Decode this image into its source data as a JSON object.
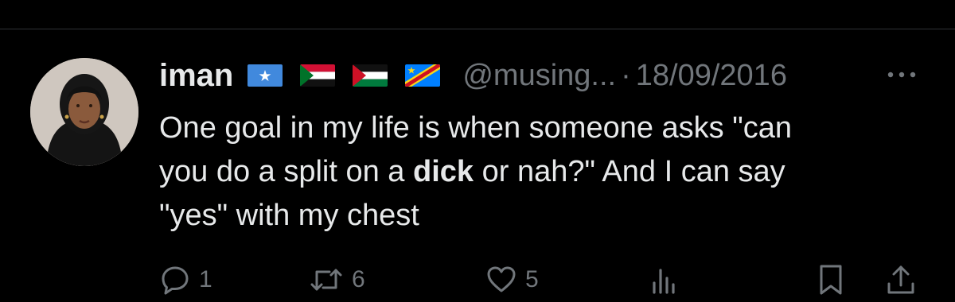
{
  "tweet": {
    "display_name": "iman",
    "handle": "@musing...",
    "separator": "·",
    "date": "18/09/2016",
    "flags": [
      "somalia-flag",
      "sudan-flag",
      "palestine-flag",
      "dr-congo-flag"
    ],
    "text_part1": "One goal in my life is when someone asks \"can\nyou do a split on a ",
    "text_bold": "dick",
    "text_part2": " or nah?\" And I can say\n\"yes\" with my chest"
  },
  "actions": {
    "reply_count": "1",
    "retweet_count": "6",
    "like_count": "5"
  },
  "icons": [
    "more-icon",
    "reply-icon",
    "retweet-icon",
    "like-icon",
    "views-icon",
    "bookmark-icon",
    "share-icon"
  ],
  "colors": {
    "background": "#000000",
    "text": "#e7e9ea",
    "muted": "#71767b"
  }
}
